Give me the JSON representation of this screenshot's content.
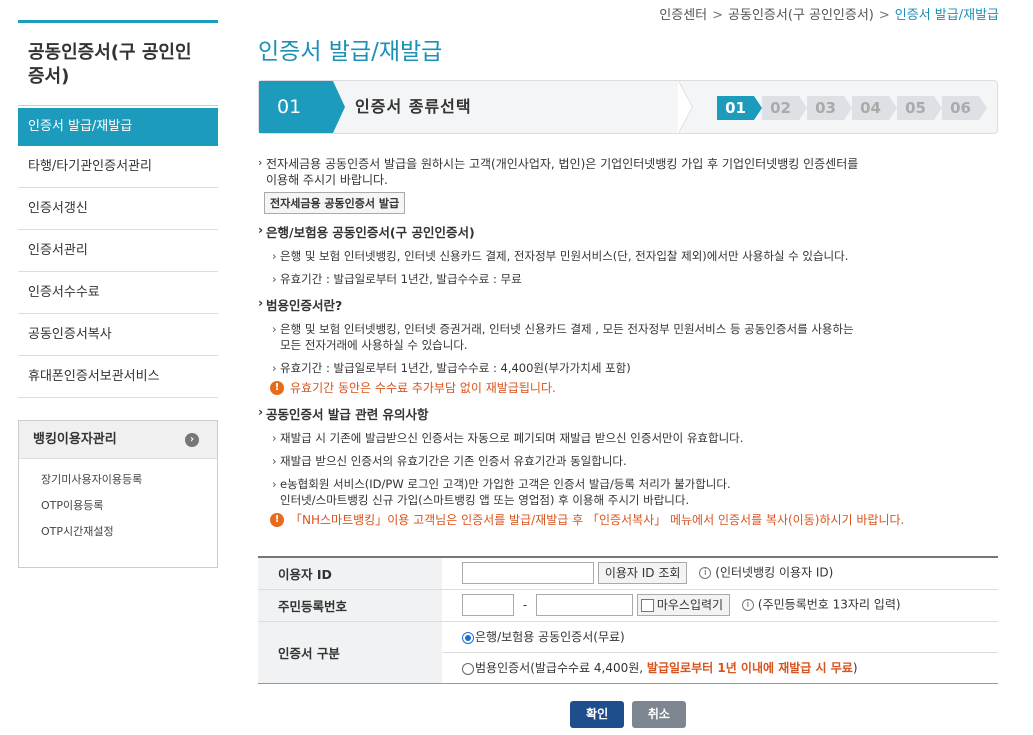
{
  "breadcrumb": [
    "인증센터",
    "공동인증서(구 공인인증서)",
    "인증서 발급/재발급"
  ],
  "sidebar": {
    "title": "공동인증서(구 공인인증서)",
    "items": [
      {
        "label": "인증서 발급/재발급",
        "active": true
      },
      {
        "label": "타행/타기관인증서관리"
      },
      {
        "label": "인증서갱신"
      },
      {
        "label": "인증서관리"
      },
      {
        "label": "인증서수수료"
      },
      {
        "label": "공동인증서복사"
      },
      {
        "label": "휴대폰인증서보관서비스"
      }
    ],
    "sub": {
      "title": "뱅킹이용자관리",
      "items": [
        "장기미사용자이용등록",
        "OTP이용등록",
        "OTP시간재설정"
      ]
    }
  },
  "main": {
    "title": "인증서 발급/재발급",
    "step_number": "01",
    "step_label": "인증서 종류선택",
    "steps": [
      "01",
      "02",
      "03",
      "04",
      "05",
      "06"
    ],
    "intro_line1": "전자세금용 공동인증서 발급을 원하시는 고객(개인사업자, 법인)은 기업인터넷뱅킹 가입 후 기업인터넷뱅킹 인증센터를",
    "intro_line2": "이용해 주시기 바랍니다.",
    "intro_button": "전자세금용 공동인증서 발급",
    "s1_title": "은행/보험용 공동인증서(구 공인인증서)",
    "s1_b1": "은행 및 보험 인터넷뱅킹, 인터넷 신용카드 결제, 전자정부 민원서비스(단, 전자입찰 제외)에서만 사용하실 수 있습니다.",
    "s1_b2": "유효기간 : 발급일로부터 1년간, 발급수수료 : 무료",
    "s2_title": "범용인증서란?",
    "s2_b1_l1": "은행 및 보험 인터넷뱅킹, 인터넷 증권거래, 인터넷 신용카드 결제 , 모든 전자정부 민원서비스 등 공동인증서를 사용하는",
    "s2_b1_l2": "모든 전자거래에 사용하실 수 있습니다.",
    "s2_b2": "유효기간 : 발급일로부터 1년간, 발급수수료 : 4,400원(부가가치세 포함)",
    "s2_warn": "유효기간 동안은 수수료 추가부담 없이 재발급됩니다.",
    "s3_title": "공동인증서 발급 관련 유의사항",
    "s3_b1": "재발급 시 기존에 발급받으신 인증서는 자동으로 폐기되며 재발급 받으신 인증서만이 유효합니다.",
    "s3_b2": "재발급 받으신 인증서의 유효기간은 기존 인증서 유효기간과 동일합니다.",
    "s3_b3_l1": "e농협회원 서비스(ID/PW 로그인 고객)만 가입한 고객은 인증서 발급/등록 처리가 불가합니다.",
    "s3_b3_l2": "인터넷/스마트뱅킹 신규 가입(스마트뱅킹 앱 또는 영업점) 후 이용해 주시기 바랍니다.",
    "s3_warn": "「NH스마트뱅킹」이용 고객님은 인증서를 발급/재발급 후 「인증서복사」 메뉴에서 인증서를 복사(이동)하시기 바랍니다.",
    "info_icon": "i",
    "warn_icon": "!"
  },
  "form": {
    "user_id_label": "이용자 ID",
    "user_id_value": "",
    "user_id_button": "이용자 ID 조회",
    "user_id_hint": "(인터넷뱅킹 이용자 ID)",
    "rrn_label": "주민등록번호",
    "rrn_dash": "-",
    "rrn_mouse_label": "마우스입력기",
    "rrn_hint": "(주민등록번호 13자리 입력)",
    "cert_type_label": "인증서 구분",
    "option1": "은행/보험용 공동인증서(무료)",
    "option2_text": "범용인증서(발급수수료 4,400원, ",
    "option2_highlight": "발급일로부터 1년 이내에 재발급 시 무료",
    "option2_close": ")",
    "selected_option": 1
  },
  "buttons": {
    "confirm": "확인",
    "cancel": "취소"
  }
}
